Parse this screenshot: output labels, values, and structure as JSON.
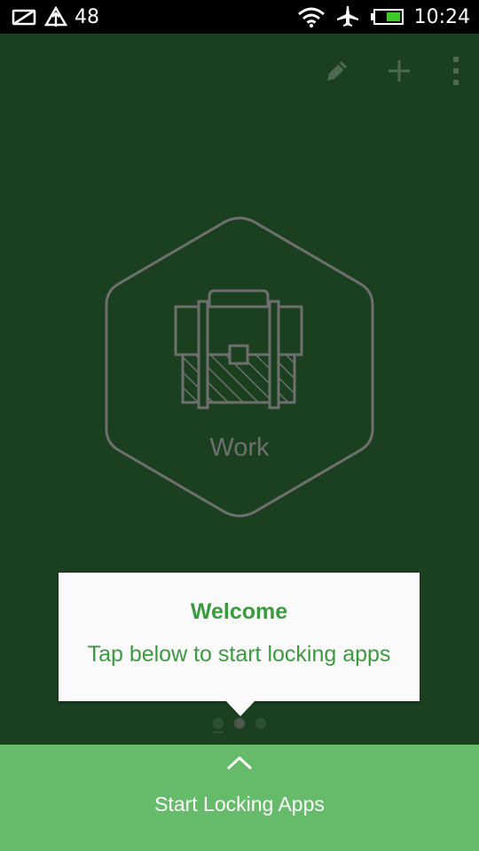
{
  "status_bar": {
    "notification_count": "48",
    "time": "10:24"
  },
  "toolbar": {
    "icons": [
      "edit-icon",
      "add-icon",
      "more-vertical-icon"
    ]
  },
  "profile": {
    "label": "Work",
    "icon": "briefcase-icon"
  },
  "tooltip": {
    "title": "Welcome",
    "message": "Tap below to start locking apps"
  },
  "pager": {
    "count": 3,
    "active_index": 1
  },
  "bottom_bar": {
    "label": "Start Locking Apps",
    "icon": "chevron-up-icon"
  },
  "colors": {
    "background": "#1b4020",
    "accent_green": "#65bb6a",
    "tooltip_text": "#3a9a3e",
    "hex_outline": "#6f6f6f"
  }
}
